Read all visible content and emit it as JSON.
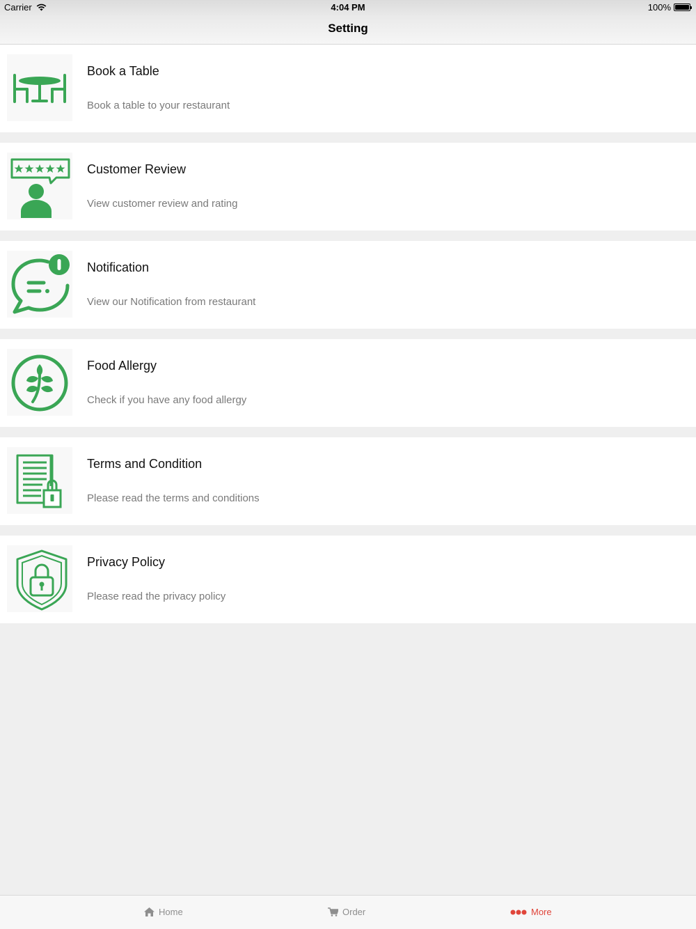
{
  "status_bar": {
    "carrier": "Carrier",
    "time": "4:04 PM",
    "battery": "100%"
  },
  "nav": {
    "title": "Setting"
  },
  "colors": {
    "icon_green": "#3aa655",
    "active_tab": "#e0453a",
    "inactive_tab": "#8e8e8e"
  },
  "items": [
    {
      "title": "Book a Table",
      "subtitle": "Book a table to  your restaurant",
      "icon": "table-icon"
    },
    {
      "title": "Customer Review",
      "subtitle": "View customer review and rating",
      "icon": "review-icon"
    },
    {
      "title": "Notification",
      "subtitle": "View our Notification from restaurant",
      "icon": "notification-icon"
    },
    {
      "title": "Food Allergy",
      "subtitle": "Check if you have any food allergy",
      "icon": "allergy-icon"
    },
    {
      "title": "Terms and Condition",
      "subtitle": "Please read the terms and conditions",
      "icon": "terms-icon"
    },
    {
      "title": "Privacy Policy",
      "subtitle": "Please read the privacy policy",
      "icon": "privacy-icon"
    }
  ],
  "tabs": [
    {
      "label": "Home",
      "icon": "home-icon",
      "active": false
    },
    {
      "label": "Order",
      "icon": "cart-icon",
      "active": false
    },
    {
      "label": "More",
      "icon": "more-icon",
      "active": true
    }
  ]
}
